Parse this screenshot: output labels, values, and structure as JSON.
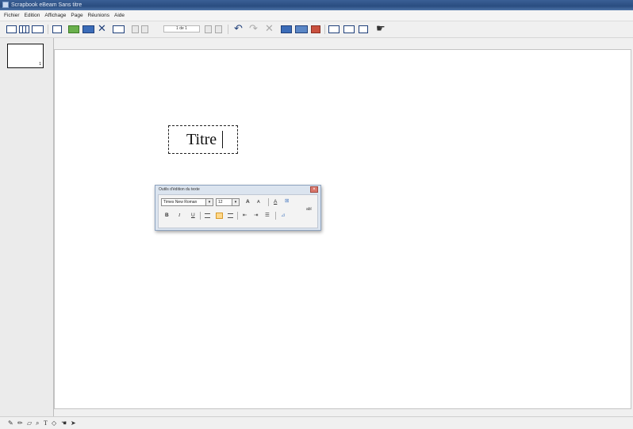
{
  "window": {
    "title": "Scrapbook eBeam Sans titre"
  },
  "menu": [
    "Fichier",
    "Edition",
    "Affichage",
    "Page",
    "Réunions",
    "Aide"
  ],
  "toolbar": {
    "page_indicator": "1 de 1"
  },
  "sidebar": {
    "thumbnail_number": "1"
  },
  "canvas": {
    "text": "Titre"
  },
  "text_tools": {
    "title": "Outils d'édition du texte",
    "font": "Times New Roman",
    "size": "12",
    "bold": "B",
    "italic": "I",
    "underline": "U",
    "grow": "A",
    "shrink": "A"
  },
  "bottom_tools": {
    "text_tool": "T"
  },
  "colors": {
    "titlebar": "#2a4d80",
    "canvas": "#ffffff",
    "accent": "#1f3f7a"
  }
}
